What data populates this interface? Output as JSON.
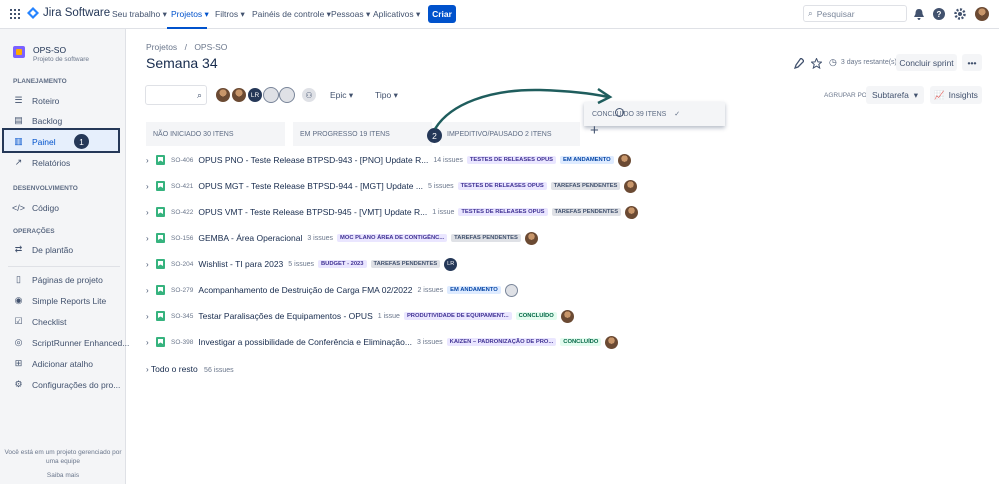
{
  "topbar": {
    "app_name": "Jira Software",
    "nav": [
      "Seu trabalho",
      "Projetos",
      "Filtros",
      "Painéis de controle",
      "Pessoas",
      "Aplicativos"
    ],
    "create": "Criar",
    "search_placeholder": "Pesquisar"
  },
  "sidebar": {
    "project_name": "OPS-SO",
    "project_type": "Projeto de software",
    "sections": {
      "planning": "PLANEJAMENTO",
      "development": "DESENVOLVIMENTO",
      "operations": "OPERAÇÕES"
    },
    "items": {
      "roteiro": "Roteiro",
      "backlog": "Backlog",
      "painel": "Painel",
      "relatorios": "Relatórios",
      "codigo": "Código",
      "plantao": "De plantão",
      "paginas": "Páginas de projeto",
      "simple_reports": "Simple Reports Lite",
      "checklist": "Checklist",
      "scriptrunner": "ScriptRunner Enhanced...",
      "atalho": "Adicionar atalho",
      "config": "Configurações do pro..."
    },
    "footer": "Você está em um projeto gerenciado por uma equipe",
    "footer_link": "Saiba mais"
  },
  "badges": {
    "one": "1",
    "two": "2"
  },
  "header": {
    "breadcrumb": [
      "Projetos",
      "OPS-SO"
    ],
    "title": "Semana 34",
    "days_left": "3 days restante(s)",
    "complete_sprint": "Concluir sprint",
    "more": "•••"
  },
  "filters": {
    "avatar_lr": "LR",
    "epic": "Epic",
    "type": "Tipo",
    "group_label": "AGRUPAR POR",
    "group_value": "Subtarefa",
    "insights": "Insights"
  },
  "columns": {
    "todo": "NÃO INICIADO 30 ITENS",
    "progress": "EM PROGRESSO 19 ITENS",
    "blocked": "IMPEDITIVO/PAUSADO 2 ITENS",
    "done_drag": "CONCLUÍDO 39 ITENS"
  },
  "rows": [
    {
      "key": "SO-406",
      "summary": "OPUS PNO - Teste Release BTPSD-943 - [PNO] Update R...",
      "count": "14 issues",
      "epic": "TESTES DE RELEASES OPUS",
      "status": "EM ANDAMENTO"
    },
    {
      "key": "SO-421",
      "summary": "OPUS MGT - Teste Release BTPSD-944 - [MGT] Update ...",
      "count": "5 issues",
      "epic": "TESTES DE RELEASES OPUS",
      "status": "TAREFAS PENDENTES"
    },
    {
      "key": "SO-422",
      "summary": "OPUS VMT - Teste Release BTPSD-945 - [VMT] Update R...",
      "count": "1 issue",
      "epic": "TESTES DE RELEASES OPUS",
      "status": "TAREFAS PENDENTES"
    },
    {
      "key": "SO-156",
      "summary": "GEMBA - Área Operacional",
      "count": "3 issues",
      "epic": "MOC PLANO ÁREA DE CONTIGÊNC...",
      "status": "TAREFAS PENDENTES"
    },
    {
      "key": "SO-204",
      "summary": "Wishlist - TI para 2023",
      "count": "5 issues",
      "epic": "BUDGET - 2023",
      "status": "TAREFAS PENDENTES",
      "assignee": "LR"
    },
    {
      "key": "SO-279",
      "summary": "Acompanhamento de Destruição de Carga FMA 02/2022",
      "count": "2 issues",
      "epic": "",
      "status": "EM ANDAMENTO"
    },
    {
      "key": "SO-345",
      "summary": "Testar Paralisações de Equipamentos - OPUS",
      "count": "1 issue",
      "epic": "PRODUTIVIDADE DE EQUIPAMENT...",
      "status": "CONCLUÍDO"
    },
    {
      "key": "SO-398",
      "summary": "Investigar a possibilidade de Conferência e Eliminação...",
      "count": "3 issues",
      "epic": "KAIZEN – PADRONIZAÇÃO DE PRO...",
      "status": "CONCLUÍDO"
    }
  ],
  "rest": {
    "label": "Todo o resto",
    "count": "56 issues"
  },
  "colors": {
    "accent": "#0052cc",
    "done": "#36b37e",
    "arrow": "#1f5d5d"
  }
}
